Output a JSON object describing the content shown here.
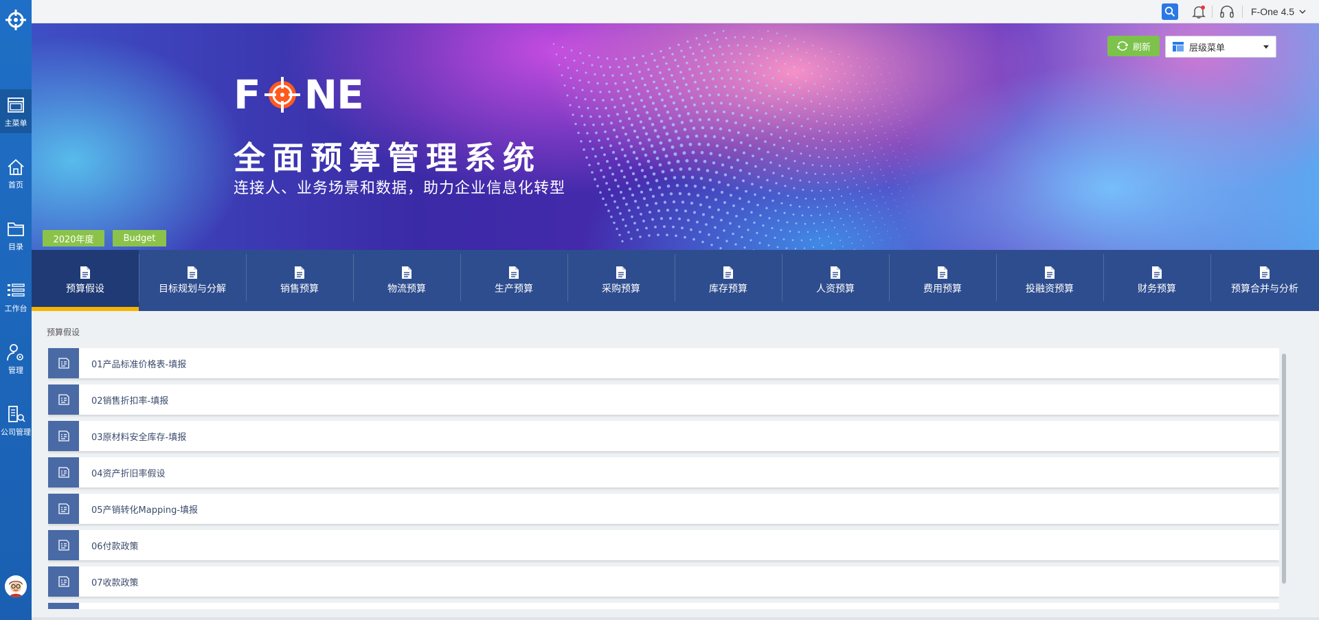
{
  "sidebar": {
    "items": [
      {
        "label": "主菜单",
        "icon": "window-icon"
      },
      {
        "label": "首页",
        "icon": "home-icon"
      },
      {
        "label": "目录",
        "icon": "folder-icon"
      },
      {
        "label": "工作台",
        "icon": "list-icon"
      },
      {
        "label": "管理",
        "icon": "user-gear-icon"
      },
      {
        "label": "公司管理",
        "icon": "company-icon"
      }
    ]
  },
  "topbar": {
    "user": "F-One 4.5"
  },
  "banner": {
    "logo_f": "F",
    "logo_ne": "NE",
    "title": "全面预算管理系统",
    "subtitle": "连接人、业务场景和数据，助力企业信息化转型",
    "refresh_label": "刷新",
    "menu_select": "层级菜单",
    "tags": [
      "2020年度",
      "Budget"
    ],
    "colors": {
      "tag": "#8bc34a",
      "refresh": "#7cc24b"
    }
  },
  "modules": [
    {
      "label": "预算假设"
    },
    {
      "label": "目标规划与分解"
    },
    {
      "label": "销售预算"
    },
    {
      "label": "物流预算"
    },
    {
      "label": "生产预算"
    },
    {
      "label": "采购预算"
    },
    {
      "label": "库存预算"
    },
    {
      "label": "人资预算"
    },
    {
      "label": "费用预算"
    },
    {
      "label": "投融资预算"
    },
    {
      "label": "财务预算"
    },
    {
      "label": "预算合并与分析"
    }
  ],
  "content": {
    "section_title": "预算假设",
    "items": [
      "01产品标准价格表-填报",
      "02销售折扣率-填报",
      "03原材料安全库存-填报",
      "04资产折旧率假设",
      "05产销转化Mapping-填报",
      "06付款政策",
      "07收款政策",
      ""
    ]
  }
}
